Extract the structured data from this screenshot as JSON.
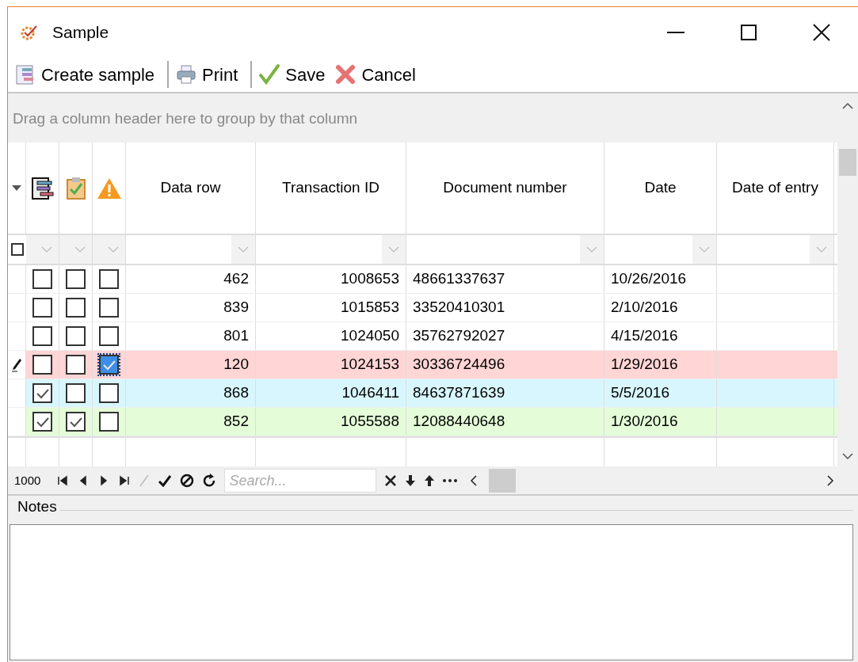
{
  "window": {
    "title": "Sample"
  },
  "toolbar": [
    {
      "label": "Create sample"
    },
    {
      "label": "Print"
    },
    {
      "label": "Save"
    },
    {
      "label": "Cancel"
    }
  ],
  "grid": {
    "group_panel": "Drag a column header here to group by that column",
    "columns": [
      {
        "label": "Data row"
      },
      {
        "label": "Transaction ID"
      },
      {
        "label": "Document number"
      },
      {
        "label": "Date"
      },
      {
        "label": "Date of entry"
      }
    ],
    "filter_all_checked": false,
    "rows": [
      {
        "editing": false,
        "color": "#ffffff",
        "checks": [
          {
            "checked": false,
            "focused": false
          },
          {
            "checked": false,
            "focused": false
          },
          {
            "checked": false,
            "focused": false
          }
        ],
        "cells": [
          "462",
          "1008653",
          "48661337637",
          "10/26/2016"
        ]
      },
      {
        "editing": false,
        "color": "#ffffff",
        "checks": [
          {
            "checked": false,
            "focused": false
          },
          {
            "checked": false,
            "focused": false
          },
          {
            "checked": false,
            "focused": false
          }
        ],
        "cells": [
          "839",
          "1015853",
          "33520410301",
          "2/10/2016"
        ]
      },
      {
        "editing": false,
        "color": "#ffffff",
        "checks": [
          {
            "checked": false,
            "focused": false
          },
          {
            "checked": false,
            "focused": false
          },
          {
            "checked": false,
            "focused": false
          }
        ],
        "cells": [
          "801",
          "1024050",
          "35762792027",
          "4/15/2016"
        ]
      },
      {
        "editing": true,
        "color": "#ffd5d5",
        "checks": [
          {
            "checked": false,
            "focused": false
          },
          {
            "checked": false,
            "focused": false
          },
          {
            "checked": true,
            "focused": true
          }
        ],
        "cells": [
          "120",
          "1024153",
          "30336724496",
          "1/29/2016"
        ]
      },
      {
        "editing": false,
        "color": "#d8f6fd",
        "checks": [
          {
            "checked": true,
            "focused": false
          },
          {
            "checked": false,
            "focused": false
          },
          {
            "checked": false,
            "focused": false
          }
        ],
        "cells": [
          "868",
          "1046411",
          "84637871639",
          "5/5/2016"
        ]
      },
      {
        "editing": false,
        "color": "#e4fcd8",
        "checks": [
          {
            "checked": true,
            "focused": false
          },
          {
            "checked": true,
            "focused": false
          },
          {
            "checked": false,
            "focused": false
          }
        ],
        "cells": [
          "852",
          "1055588",
          "12088440648",
          "1/30/2016"
        ]
      }
    ],
    "navigator": {
      "record_count": "1000",
      "search": {
        "placeholder": "Search..."
      }
    }
  },
  "notes": {
    "label": "Notes"
  }
}
